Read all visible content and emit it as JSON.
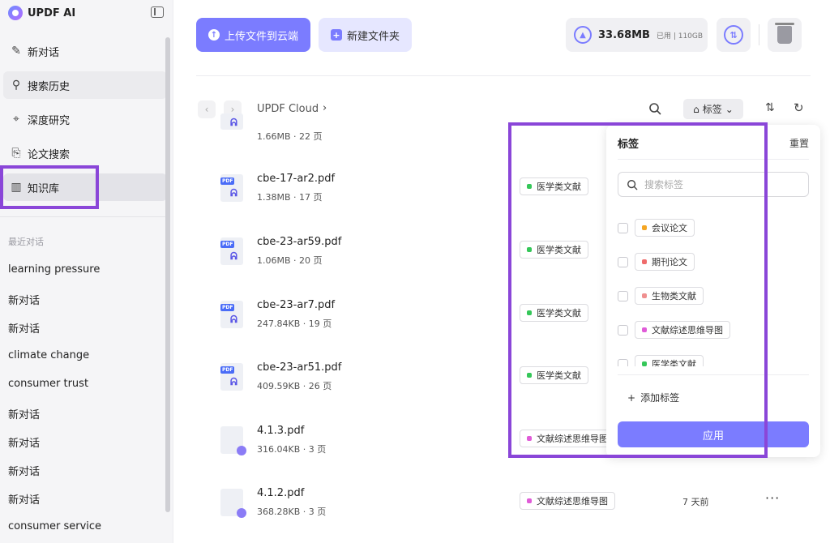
{
  "app": {
    "title": "UPDF AI"
  },
  "sidebar": {
    "nav": [
      {
        "label": "新对话",
        "icon": "edit-icon"
      },
      {
        "label": "搜索历史",
        "icon": "search-icon"
      },
      {
        "label": "深度研究",
        "icon": "telescope-icon"
      },
      {
        "label": "论文搜索",
        "icon": "paper-search-icon"
      },
      {
        "label": "知识库",
        "icon": "library-icon"
      }
    ],
    "recent_label": "最近对话",
    "recent": [
      "learning pressure",
      "新对话",
      "新对话",
      "climate change",
      "consumer trust",
      "新对话",
      "新对话",
      "新对话",
      "新对话",
      "consumer service"
    ]
  },
  "toolbar": {
    "upload_label": "上传文件到云端",
    "new_folder_label": "新建文件夹",
    "storage_used": "33.68MB",
    "storage_total": "已用 | 110GB"
  },
  "breadcrumb": {
    "root": "UPDF Cloud"
  },
  "filter": {
    "tag_label": "标签"
  },
  "files": [
    {
      "name": "",
      "meta": "1.66MB · 22 页",
      "tag": "",
      "tag_color": "",
      "date": "",
      "type": "pdf"
    },
    {
      "name": "cbe-17-ar2.pdf",
      "meta": "1.38MB · 17 页",
      "tag": "医学类文献",
      "tag_color": "#35c759",
      "date": "",
      "type": "pdf"
    },
    {
      "name": "cbe-23-ar59.pdf",
      "meta": "1.06MB · 20 页",
      "tag": "医学类文献",
      "tag_color": "#35c759",
      "date": "",
      "type": "pdf"
    },
    {
      "name": "cbe-23-ar7.pdf",
      "meta": "247.84KB · 19 页",
      "tag": "医学类文献",
      "tag_color": "#35c759",
      "date": "",
      "type": "pdf"
    },
    {
      "name": "cbe-23-ar51.pdf",
      "meta": "409.59KB · 26 页",
      "tag": "医学类文献",
      "tag_color": "#35c759",
      "date": "",
      "type": "pdf"
    },
    {
      "name": "4.1.3.pdf",
      "meta": "316.04KB · 3 页",
      "tag": "文献综述思维导图",
      "tag_color": "#e05cd8",
      "date": "",
      "type": "doc"
    },
    {
      "name": "4.1.2.pdf",
      "meta": "368.28KB · 3 页",
      "tag": "文献综述思维导图",
      "tag_color": "#e05cd8",
      "date": "7 天前",
      "type": "doc"
    }
  ],
  "tag_panel": {
    "title": "标签",
    "reset": "重置",
    "search_placeholder": "搜索标签",
    "tags": [
      {
        "label": "会议论文",
        "color": "#f5a623"
      },
      {
        "label": "期刊论文",
        "color": "#ef6b6b"
      },
      {
        "label": "生物类文献",
        "color": "#ef8f8f"
      },
      {
        "label": "文献综述思维导图",
        "color": "#e05cd8"
      },
      {
        "label": "医学类文献",
        "color": "#35c759"
      }
    ],
    "add_label": "添加标签",
    "apply_label": "应用"
  },
  "colors": {
    "accent": "#7b7cff",
    "highlight": "#8a46d8"
  }
}
